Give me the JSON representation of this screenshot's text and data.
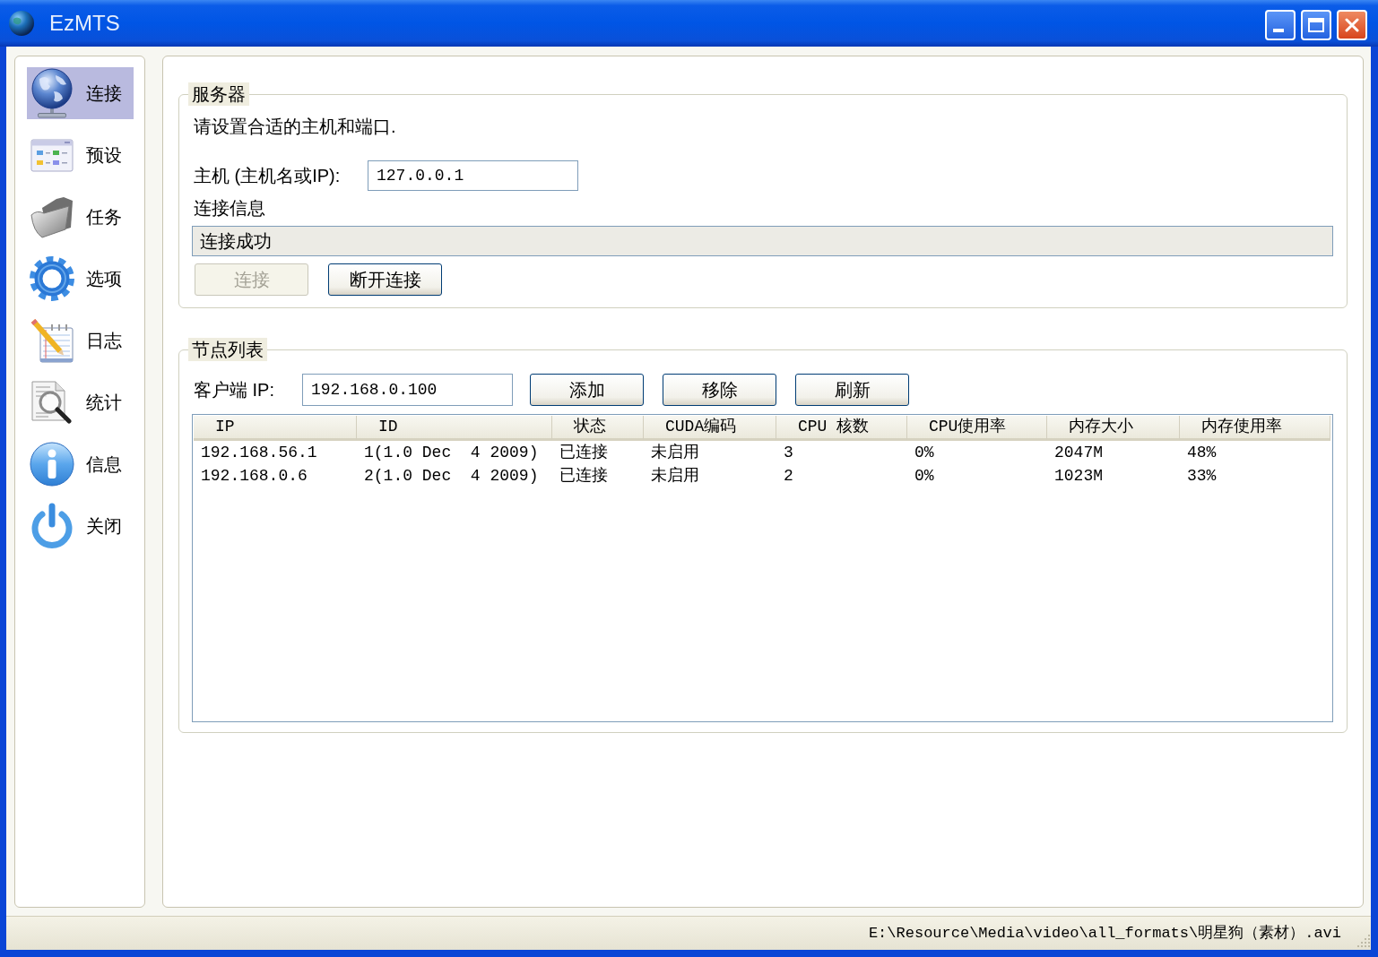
{
  "window": {
    "title": "EzMTS"
  },
  "sidebar": {
    "items": [
      {
        "label": "连接",
        "selected": true
      },
      {
        "label": "预设",
        "selected": false
      },
      {
        "label": "任务",
        "selected": false
      },
      {
        "label": "选项",
        "selected": false
      },
      {
        "label": "日志",
        "selected": false
      },
      {
        "label": "统计",
        "selected": false
      },
      {
        "label": "信息",
        "selected": false
      },
      {
        "label": "关闭",
        "selected": false
      }
    ]
  },
  "server": {
    "title": "服务器",
    "hint": "请设置合适的主机和端口.",
    "host_label": "主机 (主机名或IP):",
    "host": "127.0.0.1",
    "info_label": "连接信息",
    "info": "连接成功",
    "buttons": [
      {
        "label": "连接",
        "disabled": true
      },
      {
        "label": "断开连接",
        "disabled": false
      }
    ]
  },
  "nodes": {
    "title": "节点列表",
    "client_ip_label": "客户端 IP:",
    "client_ip": "192.168.0.100",
    "buttons": [
      {
        "label": "添加",
        "disabled": false
      },
      {
        "label": "移除",
        "disabled": false
      },
      {
        "label": "刷新",
        "disabled": false
      }
    ],
    "table": {
      "columns": [
        "IP",
        "ID",
        "状态",
        "CUDA编码",
        "CPU 核数",
        "CPU使用率",
        "内存大小",
        "内存使用率"
      ],
      "rows": [
        [
          "192.168.56.1",
          "1(1.0 Dec  4 2009)",
          "已连接",
          "未启用",
          "3",
          "0%",
          "2047M",
          "48%"
        ],
        [
          "192.168.0.6",
          "2(1.0 Dec  4 2009)",
          "已连接",
          "未启用",
          "2",
          "0%",
          "1023M",
          "33%"
        ]
      ]
    }
  },
  "status_bar": {
    "path": "E:\\Resource\\Media\\video\\all_formats\\明星狗（素材）.avi"
  }
}
